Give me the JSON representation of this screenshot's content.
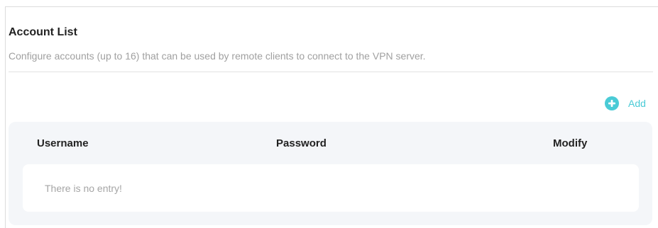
{
  "section": {
    "title": "Account List",
    "description": "Configure accounts (up to 16) that can be used by remote clients to connect to the VPN server."
  },
  "toolbar": {
    "add_label": "Add",
    "add_icon": "plus-circle-icon",
    "accent_color": "#4acbd6"
  },
  "table": {
    "columns": [
      "Username",
      "Password",
      "Modify"
    ],
    "rows": [],
    "empty_message": "There is no entry!"
  }
}
